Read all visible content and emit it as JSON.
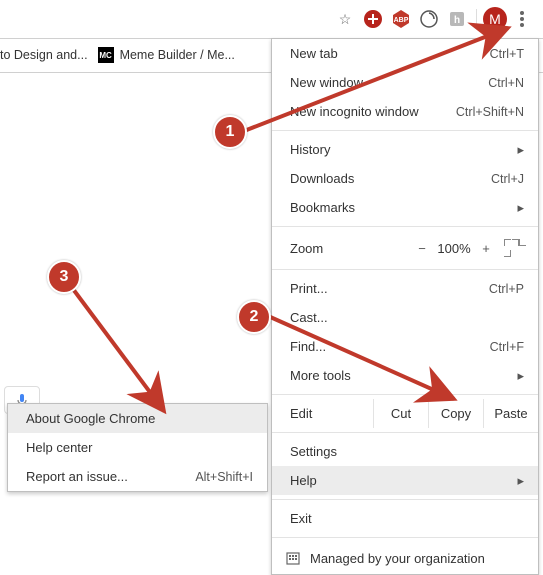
{
  "bookmarks_bar": {
    "item1_label": "to Design and...",
    "item2_label": "Meme Builder / Me..."
  },
  "toolbar": {
    "profile_initial": "M"
  },
  "menu": {
    "new_tab": "New tab",
    "new_tab_sc": "Ctrl+T",
    "new_window": "New window",
    "new_window_sc": "Ctrl+N",
    "incognito": "New incognito window",
    "incognito_sc": "Ctrl+Shift+N",
    "history": "History",
    "downloads": "Downloads",
    "downloads_sc": "Ctrl+J",
    "bookmarks": "Bookmarks",
    "zoom_lbl": "Zoom",
    "zoom_minus": "−",
    "zoom_pct": "100%",
    "zoom_plus": "+",
    "print": "Print...",
    "print_sc": "Ctrl+P",
    "cast": "Cast...",
    "find": "Find...",
    "find_sc": "Ctrl+F",
    "moretools": "More tools",
    "edit": "Edit",
    "cut": "Cut",
    "copy": "Copy",
    "paste": "Paste",
    "settings": "Settings",
    "help": "Help",
    "exit": "Exit",
    "managed": "Managed by your organization"
  },
  "help_submenu": {
    "about": "About Google Chrome",
    "help_center": "Help center",
    "report": "Report an issue...",
    "report_sc": "Alt+Shift+I"
  },
  "annotations": {
    "n1": "1",
    "n2": "2",
    "n3": "3"
  }
}
